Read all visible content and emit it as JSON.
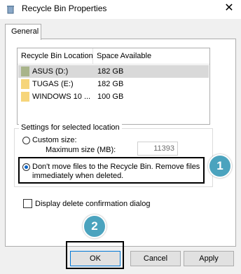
{
  "window": {
    "title": "Recycle Bin Properties",
    "close_glyph": "✕"
  },
  "tabs": [
    {
      "label": "General"
    }
  ],
  "list": {
    "headers": {
      "location": "Recycle Bin Location",
      "space": "Space Available"
    },
    "rows": [
      {
        "name": "ASUS (D:)",
        "space": "182 GB",
        "icon": "drive-icon",
        "icon_color": "#a8b48a",
        "selected": true
      },
      {
        "name": "TUGAS (E:)",
        "space": "182 GB",
        "icon": "drive-icon",
        "icon_color": "#f6d57a",
        "selected": false
      },
      {
        "name": "WINDOWS 10 ...",
        "space": "100 GB",
        "icon": "drive-icon",
        "icon_color": "#f6d57a",
        "selected": false
      }
    ]
  },
  "settings": {
    "group_label": "Settings for selected location",
    "custom_size_label": "Custom size:",
    "max_size_label": "Maximum size (MB):",
    "max_size_value": "11393",
    "dont_move_label": "Don't move files to the Recycle Bin. Remove files immediately when deleted.",
    "selected_option": "dont_move"
  },
  "confirm": {
    "label": "Display delete confirmation dialog",
    "checked": false
  },
  "annotations": {
    "badge1": "1",
    "badge2": "2",
    "badge_color": "#4ba3be"
  },
  "buttons": {
    "ok": "OK",
    "cancel": "Cancel",
    "apply": "Apply"
  }
}
